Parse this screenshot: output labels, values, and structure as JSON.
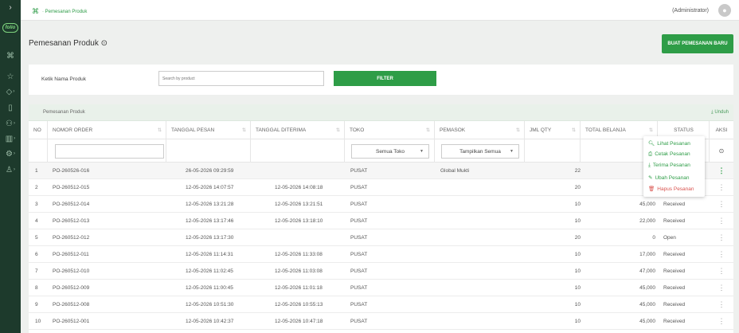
{
  "app": {
    "logo_text": "folio"
  },
  "sidebar": {
    "items": [
      {
        "icon": "command-icon",
        "glyph": "⌘",
        "arrow": ""
      },
      {
        "icon": "star-icon",
        "glyph": "☆",
        "arrow": ""
      },
      {
        "icon": "box-icon",
        "glyph": "◇",
        "arrow": "›"
      },
      {
        "icon": "tablet-icon",
        "glyph": "▯",
        "arrow": ""
      },
      {
        "icon": "users-icon",
        "glyph": "⚇",
        "arrow": "›"
      },
      {
        "icon": "chart-icon",
        "glyph": "▥",
        "arrow": "›"
      },
      {
        "icon": "settings-icon",
        "glyph": "⚙",
        "arrow": "›"
      },
      {
        "icon": "user-icon",
        "glyph": "♙",
        "arrow": "›"
      }
    ]
  },
  "topbar": {
    "breadcrumb_icon": "⌘",
    "breadcrumb": "· Pemesanan Produk",
    "user": "(Administrator)",
    "avatar_glyph": "👤"
  },
  "page": {
    "title": "Pemesanan Produk ⊙",
    "create_button": "BUAT PEMESANAN BARU"
  },
  "filter": {
    "label": "Ketik Nama Produk",
    "placeholder": "Search by product",
    "button": "FILTER"
  },
  "table": {
    "card_title": "Pemesanan Produk",
    "download": "⤓ Unduh",
    "columns": [
      "NO",
      "NOMOR ORDER",
      "TANGGAL PESAN",
      "TANGGAL DITERIMA",
      "TOKO",
      "PEMASOK",
      "JML QTY",
      "TOTAL BELANJA",
      "STATUS",
      "AKSI"
    ],
    "filters": {
      "toko": "Semua Toko",
      "pemasok": "Tampilkan Semua",
      "aksi_icon": "⊙"
    },
    "rows": [
      {
        "no": "1",
        "order": "PO-260526-016",
        "pesan": "26-05-2026 09:29:59",
        "terima": "",
        "toko": "PUSAT",
        "pemasok": "Global Mukti",
        "qty": "22",
        "total": "",
        "status": ""
      },
      {
        "no": "2",
        "order": "PO-260512-015",
        "pesan": "12-05-2026 14:07:57",
        "terima": "12-05-2026 14:08:18",
        "toko": "PUSAT",
        "pemasok": "",
        "qty": "20",
        "total": "",
        "status": ""
      },
      {
        "no": "3",
        "order": "PO-260512-014",
        "pesan": "12-05-2026 13:21:28",
        "terima": "12-05-2026 13:21:51",
        "toko": "PUSAT",
        "pemasok": "",
        "qty": "10",
        "total": "45,000",
        "status": "Received"
      },
      {
        "no": "4",
        "order": "PO-260512-013",
        "pesan": "12-05-2026 13:17:46",
        "terima": "12-05-2026 13:18:10",
        "toko": "PUSAT",
        "pemasok": "",
        "qty": "10",
        "total": "22,000",
        "status": "Received"
      },
      {
        "no": "5",
        "order": "PO-260512-012",
        "pesan": "12-05-2026 13:17:30",
        "terima": "",
        "toko": "PUSAT",
        "pemasok": "",
        "qty": "20",
        "total": "0",
        "status": "Open"
      },
      {
        "no": "6",
        "order": "PO-260512-011",
        "pesan": "12-05-2026 11:14:31",
        "terima": "12-05-2026 11:33:08",
        "toko": "PUSAT",
        "pemasok": "",
        "qty": "10",
        "total": "17,000",
        "status": "Received"
      },
      {
        "no": "7",
        "order": "PO-260512-010",
        "pesan": "12-05-2026 11:02:45",
        "terima": "12-05-2026 11:03:08",
        "toko": "PUSAT",
        "pemasok": "",
        "qty": "10",
        "total": "47,000",
        "status": "Received"
      },
      {
        "no": "8",
        "order": "PO-260512-009",
        "pesan": "12-05-2026 11:00:45",
        "terima": "12-05-2026 11:01:18",
        "toko": "PUSAT",
        "pemasok": "",
        "qty": "10",
        "total": "45,000",
        "status": "Received"
      },
      {
        "no": "9",
        "order": "PO-260512-008",
        "pesan": "12-05-2026 10:51:30",
        "terima": "12-05-2026 10:55:13",
        "toko": "PUSAT",
        "pemasok": "",
        "qty": "10",
        "total": "45,000",
        "status": "Received"
      },
      {
        "no": "10",
        "order": "PO-260512-001",
        "pesan": "12-05-2026 10:42:37",
        "terima": "12-05-2026 10:47:18",
        "toko": "PUSAT",
        "pemasok": "",
        "qty": "10",
        "total": "45,000",
        "status": "Received"
      }
    ],
    "action_glyph": "⋮"
  },
  "menu": {
    "items": [
      {
        "label": "Lihat Pesanan",
        "glyph": "🔍︎",
        "color": "#2e9d47"
      },
      {
        "label": "Cetak Pesanan",
        "glyph": "⎙",
        "color": "#2e9d47"
      },
      {
        "label": "Terima Pesanan",
        "glyph": "⤓",
        "color": "#2e9d47"
      },
      {
        "label": "Ubah Pesanan",
        "glyph": "✎",
        "color": "#2e9d47"
      },
      {
        "label": "Hapus Pesanan",
        "glyph": "🗑︎",
        "color": "#d9534f"
      }
    ]
  },
  "colors": {
    "accent": "#2e9d47",
    "sidebar": "#1d3a2c",
    "danger": "#d9534f"
  }
}
